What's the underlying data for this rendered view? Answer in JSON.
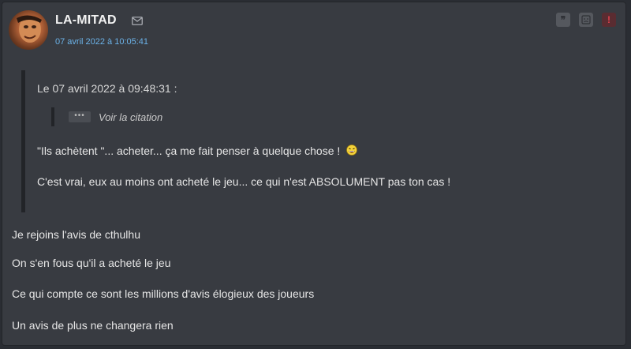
{
  "post": {
    "author": "LA-MITAD",
    "date": "07 avril 2022 à 10:05:41",
    "quote": {
      "header": "Le 07 avril 2022 à 09:48:31 :",
      "nested_dots": "•••",
      "nested_label": "Voir la citation",
      "line1": "\"Ils achètent \"... acheter... ça me fait penser à quelque chose !",
      "line2": "C'est vrai, eux au moins ont acheté le jeu... ce qui n'est ABSOLUMENT pas ton cas !"
    },
    "body": [
      "Je rejoins l'avis de cthulhu",
      "On s'en fous qu'il a acheté le jeu",
      "Ce qui compte ce sont les millions d'avis élogieux des joueurs",
      "Un avis de plus ne changera rien"
    ],
    "actions": {
      "quote_glyph": "❞",
      "report_glyph": "!"
    }
  },
  "colors": {
    "background": "#383b41",
    "date_link": "#6bb2e8",
    "report_red": "#e0414d"
  },
  "icons": [
    "mail-icon",
    "quote-icon",
    "sad-face-icon",
    "report-icon",
    "laughing-smiley-icon"
  ]
}
